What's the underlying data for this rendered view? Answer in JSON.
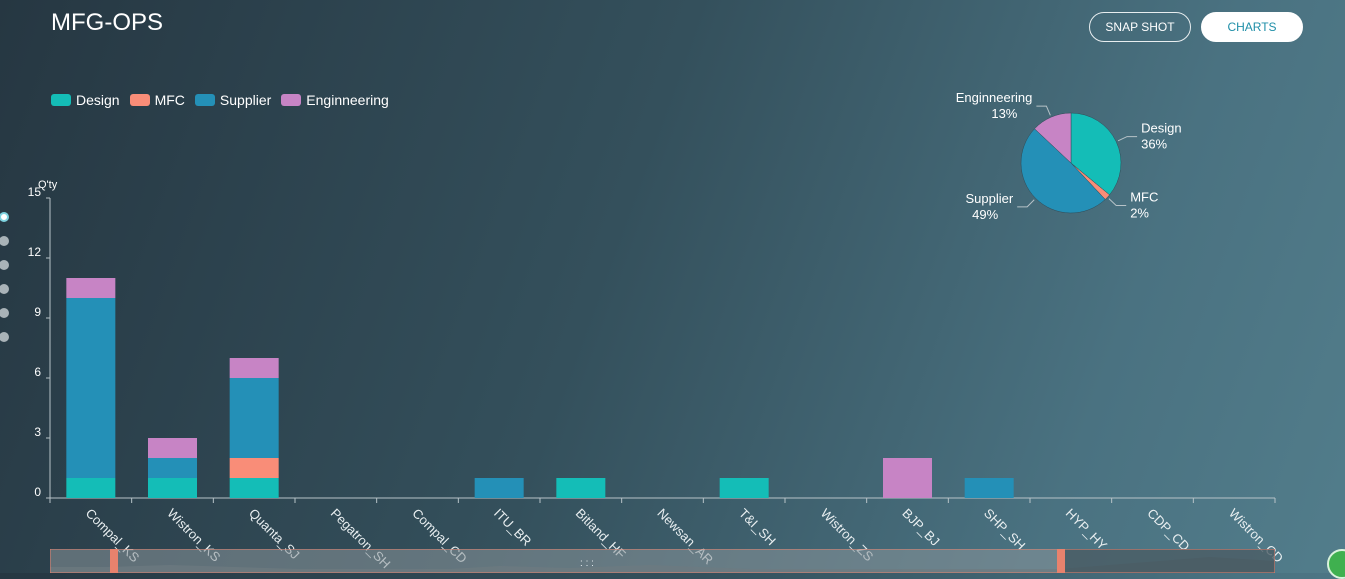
{
  "header": {
    "title": "MFG-OPS",
    "snapshot_label": "SNAP SHOT",
    "charts_label": "CHARTS"
  },
  "colors": {
    "Design": "#14bdb7",
    "MFC": "#f98d78",
    "Supplier": "#2490b7",
    "Enginneering": "#c784c5"
  },
  "side_nav": {
    "count": 6,
    "active_index": 0
  },
  "chart_data": [
    {
      "type": "bar",
      "stacked": true,
      "ylabel": "Q'ty",
      "ylim": [
        0,
        15
      ],
      "yticks": [
        0,
        3,
        6,
        9,
        12,
        15
      ],
      "grid": false,
      "legend_position": "top-left",
      "categories": [
        "Compal_KS",
        "Wistron_KS",
        "Quanta_SJ",
        "Pegatron_SH",
        "Compal_CD",
        "ITU_BR",
        "Bitland_HF",
        "Newsan_AR",
        "T&I_SH",
        "Wistron_ZS",
        "BJP_BJ",
        "SHP_SH",
        "HYP_HY",
        "CDP_CD",
        "Wistron_CD"
      ],
      "series": [
        {
          "name": "Design",
          "values": [
            1,
            1,
            1,
            0,
            0,
            0,
            1,
            0,
            1,
            0,
            0,
            0,
            0,
            0,
            0
          ]
        },
        {
          "name": "MFC",
          "values": [
            0,
            0,
            1,
            0,
            0,
            0,
            0,
            0,
            0,
            0,
            0,
            0,
            0,
            0,
            0
          ]
        },
        {
          "name": "Supplier",
          "values": [
            9,
            1,
            4,
            0,
            0,
            1,
            0,
            0,
            0,
            0,
            0,
            1,
            0,
            0,
            0
          ]
        },
        {
          "name": "Enginneering",
          "values": [
            1,
            1,
            1,
            0,
            0,
            0,
            0,
            0,
            0,
            0,
            2,
            0,
            0,
            0,
            0
          ]
        }
      ]
    },
    {
      "type": "pie",
      "slices": [
        {
          "name": "Design",
          "value": 36,
          "label": "36%"
        },
        {
          "name": "MFC",
          "value": 2,
          "label": "2%"
        },
        {
          "name": "Supplier",
          "value": 49,
          "label": "49%"
        },
        {
          "name": "Enginneering",
          "value": 13,
          "label": "13%"
        }
      ]
    }
  ]
}
